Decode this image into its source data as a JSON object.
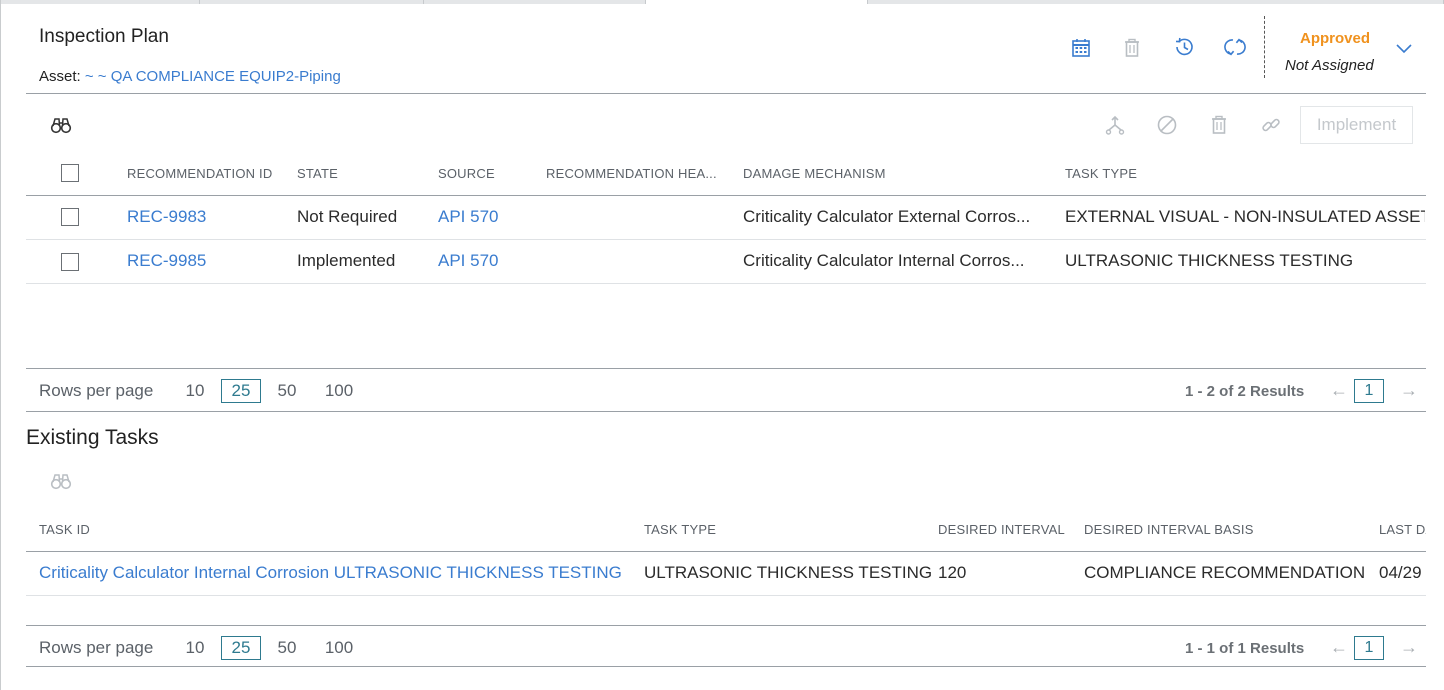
{
  "header": {
    "title": "Inspection Plan",
    "asset_label": "Asset:",
    "asset_value": "~ ~ QA COMPLIANCE EQUIP2-Piping",
    "status": "Approved",
    "assignment": "Not Assigned",
    "icons": [
      "calendar-icon",
      "trash-icon",
      "history-icon",
      "refresh-icon",
      "chevron-down-icon"
    ]
  },
  "recommendations": {
    "toolbar": {
      "implement_label": "Implement",
      "icons": [
        "binoculars-icon",
        "merge-icon",
        "disable-icon",
        "trash-icon",
        "link-icon"
      ]
    },
    "columns": [
      "RECOMMENDATION ID",
      "STATE",
      "SOURCE",
      "RECOMMENDATION HEA...",
      "DAMAGE MECHANISM",
      "TASK TYPE"
    ],
    "rows": [
      {
        "id": "REC-9983",
        "state": "Not Required",
        "source": "API 570",
        "headline": "",
        "damage": "Criticality Calculator External Corros...",
        "task_type": "EXTERNAL VISUAL - NON-INSULATED ASSET"
      },
      {
        "id": "REC-9985",
        "state": "Implemented",
        "source": "API 570",
        "headline": "",
        "damage": "Criticality Calculator Internal Corros...",
        "task_type": "ULTRASONIC THICKNESS TESTING"
      }
    ],
    "pagination": {
      "rows_per_page_label": "Rows per page",
      "options": [
        "10",
        "25",
        "50",
        "100"
      ],
      "selected": "25",
      "results": "1 - 2 of 2 Results",
      "page": "1",
      "prev": "←",
      "next": "→"
    }
  },
  "existing_tasks": {
    "title": "Existing Tasks",
    "columns": [
      "TASK ID",
      "TASK TYPE",
      "DESIRED INTERVAL",
      "DESIRED INTERVAL BASIS",
      "LAST DA"
    ],
    "rows": [
      {
        "task_id": "Criticality Calculator Internal Corrosion ULTRASONIC THICKNESS TESTING",
        "task_type": "ULTRASONIC THICKNESS TESTING",
        "interval": "120",
        "basis": "COMPLIANCE RECOMMENDATION",
        "last": "04/29"
      }
    ],
    "pagination": {
      "rows_per_page_label": "Rows per page",
      "options": [
        "10",
        "25",
        "50",
        "100"
      ],
      "selected": "25",
      "results": "1 - 1 of 1 Results",
      "page": "1",
      "prev": "←",
      "next": "→"
    }
  },
  "colors": {
    "link": "#3a7ccf",
    "approved": "#f0921e",
    "page_selected": "#2e7a8f"
  }
}
